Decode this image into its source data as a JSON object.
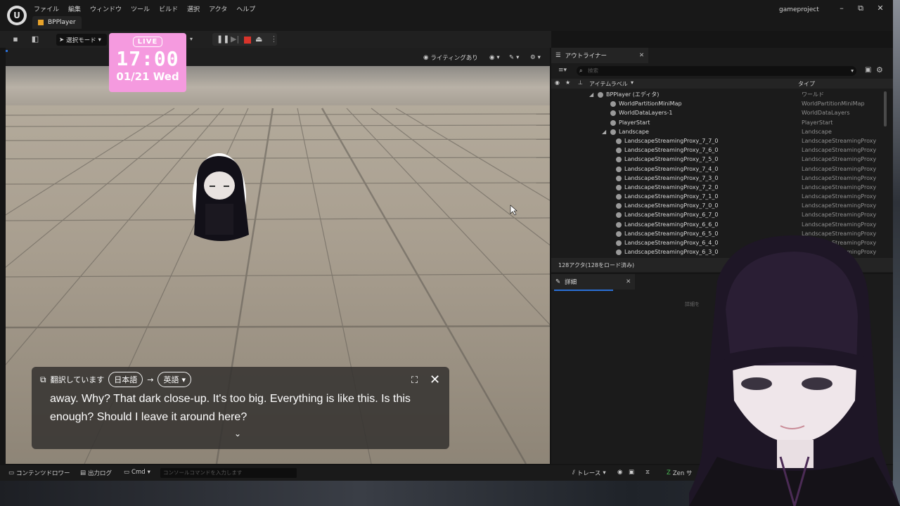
{
  "menu": [
    "ファイル",
    "編集",
    "ウィンドウ",
    "ツール",
    "ビルド",
    "選択",
    "アクタ",
    "ヘルプ"
  ],
  "document_tab": "BPPlayer",
  "project_name": "gameproject",
  "window_controls": {
    "minimize": "–",
    "maximize": "⧉",
    "close": "✕"
  },
  "toolbar": {
    "mode_label": "選択モード"
  },
  "live_overlay": {
    "badge": "LIVE",
    "time": "17:00",
    "date": "01/21 Wed"
  },
  "viewport_toolbar": {
    "lighting": "ライティングあり"
  },
  "subtitle_panel": {
    "status": "翻訳しています",
    "source_lang": "日本語",
    "arrow": "→",
    "target_lang": "英語",
    "text": "away. Why? That dark close-up. It's too big. Everything is like this. Is this enough? Should I leave it around here?"
  },
  "outliner": {
    "tab_label": "アウトライナー",
    "search_placeholder": "検索",
    "col_label": "アイテムラベル",
    "col_type": "タイプ",
    "rows": [
      {
        "label": "BPPlayer (エディタ)",
        "type": "ワールド"
      },
      {
        "label": "WorldPartitionMiniMap",
        "type": "WorldPartitionMiniMap"
      },
      {
        "label": "WorldDataLayers-1",
        "type": "WorldDataLayers"
      },
      {
        "label": "PlayerStart",
        "type": "PlayerStart"
      },
      {
        "label": "Landscape",
        "type": "Landscape"
      },
      {
        "label": "LandscapeStreamingProxy_7_7_0",
        "type": "LandscapeStreamingProxy"
      },
      {
        "label": "LandscapeStreamingProxy_7_6_0",
        "type": "LandscapeStreamingProxy"
      },
      {
        "label": "LandscapeStreamingProxy_7_5_0",
        "type": "LandscapeStreamingProxy"
      },
      {
        "label": "LandscapeStreamingProxy_7_4_0",
        "type": "LandscapeStreamingProxy"
      },
      {
        "label": "LandscapeStreamingProxy_7_3_0",
        "type": "LandscapeStreamingProxy"
      },
      {
        "label": "LandscapeStreamingProxy_7_2_0",
        "type": "LandscapeStreamingProxy"
      },
      {
        "label": "LandscapeStreamingProxy_7_1_0",
        "type": "LandscapeStreamingProxy"
      },
      {
        "label": "LandscapeStreamingProxy_7_0_0",
        "type": "LandscapeStreamingProxy"
      },
      {
        "label": "LandscapeStreamingProxy_6_7_0",
        "type": "LandscapeStreamingProxy"
      },
      {
        "label": "LandscapeStreamingProxy_6_6_0",
        "type": "LandscapeStreamingProxy"
      },
      {
        "label": "LandscapeStreamingProxy_6_5_0",
        "type": "LandscapeStreamingProxy"
      },
      {
        "label": "LandscapeStreamingProxy_6_4_0",
        "type": "LandscapeStreamingProxy"
      },
      {
        "label": "LandscapeStreamingProxy_6_3_0",
        "type": "LandscapeStreamingProxy"
      }
    ],
    "status": "128アクタ(128をロード済み)"
  },
  "details": {
    "tab_label": "詳細",
    "hint": "詳細を"
  },
  "bottombar": {
    "content_drawer": "コンテンツドロワー",
    "output_log": "出力ログ",
    "cmd": "Cmd",
    "console_placeholder": "コンソールコマンドを入力します",
    "trace": "トレース",
    "zen": "Zen サ"
  },
  "colors": {
    "accent_live": "#f59adf",
    "stop": "#d9342b",
    "tab_accent": "#e8a32a"
  }
}
